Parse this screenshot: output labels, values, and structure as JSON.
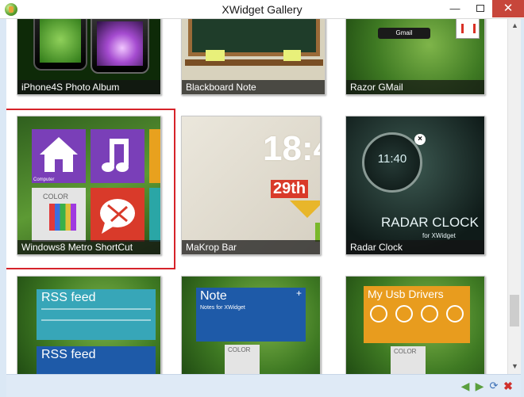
{
  "window": {
    "title": "XWidget Gallery",
    "minimize_icon": "minimize-icon",
    "maximize_icon": "maximize-icon",
    "close_icon": "close-icon"
  },
  "colors": {
    "selection_border": "#d6232a",
    "caption_bg": "#141414",
    "close_button": "#c7463b"
  },
  "tiles": [
    {
      "caption": "iPhone4S Photo Album"
    },
    {
      "caption": "Blackboard Note"
    },
    {
      "caption": "Razor GMail",
      "labels": [
        "Gmail"
      ]
    },
    {
      "caption": "Windows8 Metro ShortCut",
      "labels": [
        "Computer",
        "COLOR"
      ]
    },
    {
      "caption": "MaKrop Bar",
      "labels": [
        "18:4",
        "29th"
      ]
    },
    {
      "caption": "Radar Clock",
      "labels": [
        "11:40",
        "RADAR CLOCK",
        "for XWidget"
      ]
    },
    {
      "caption": "",
      "labels": [
        "RSS feed",
        "RSS feed"
      ]
    },
    {
      "caption": "",
      "labels": [
        "Note",
        "Notes for XWidget",
        "COLOR"
      ]
    },
    {
      "caption": "",
      "labels": [
        "My Usb Drivers",
        "COLOR"
      ]
    }
  ],
  "bottom_bar": {
    "buttons": [
      "previous-arrow-icon",
      "next-arrow-icon",
      "refresh-icon",
      "close-icon"
    ]
  }
}
